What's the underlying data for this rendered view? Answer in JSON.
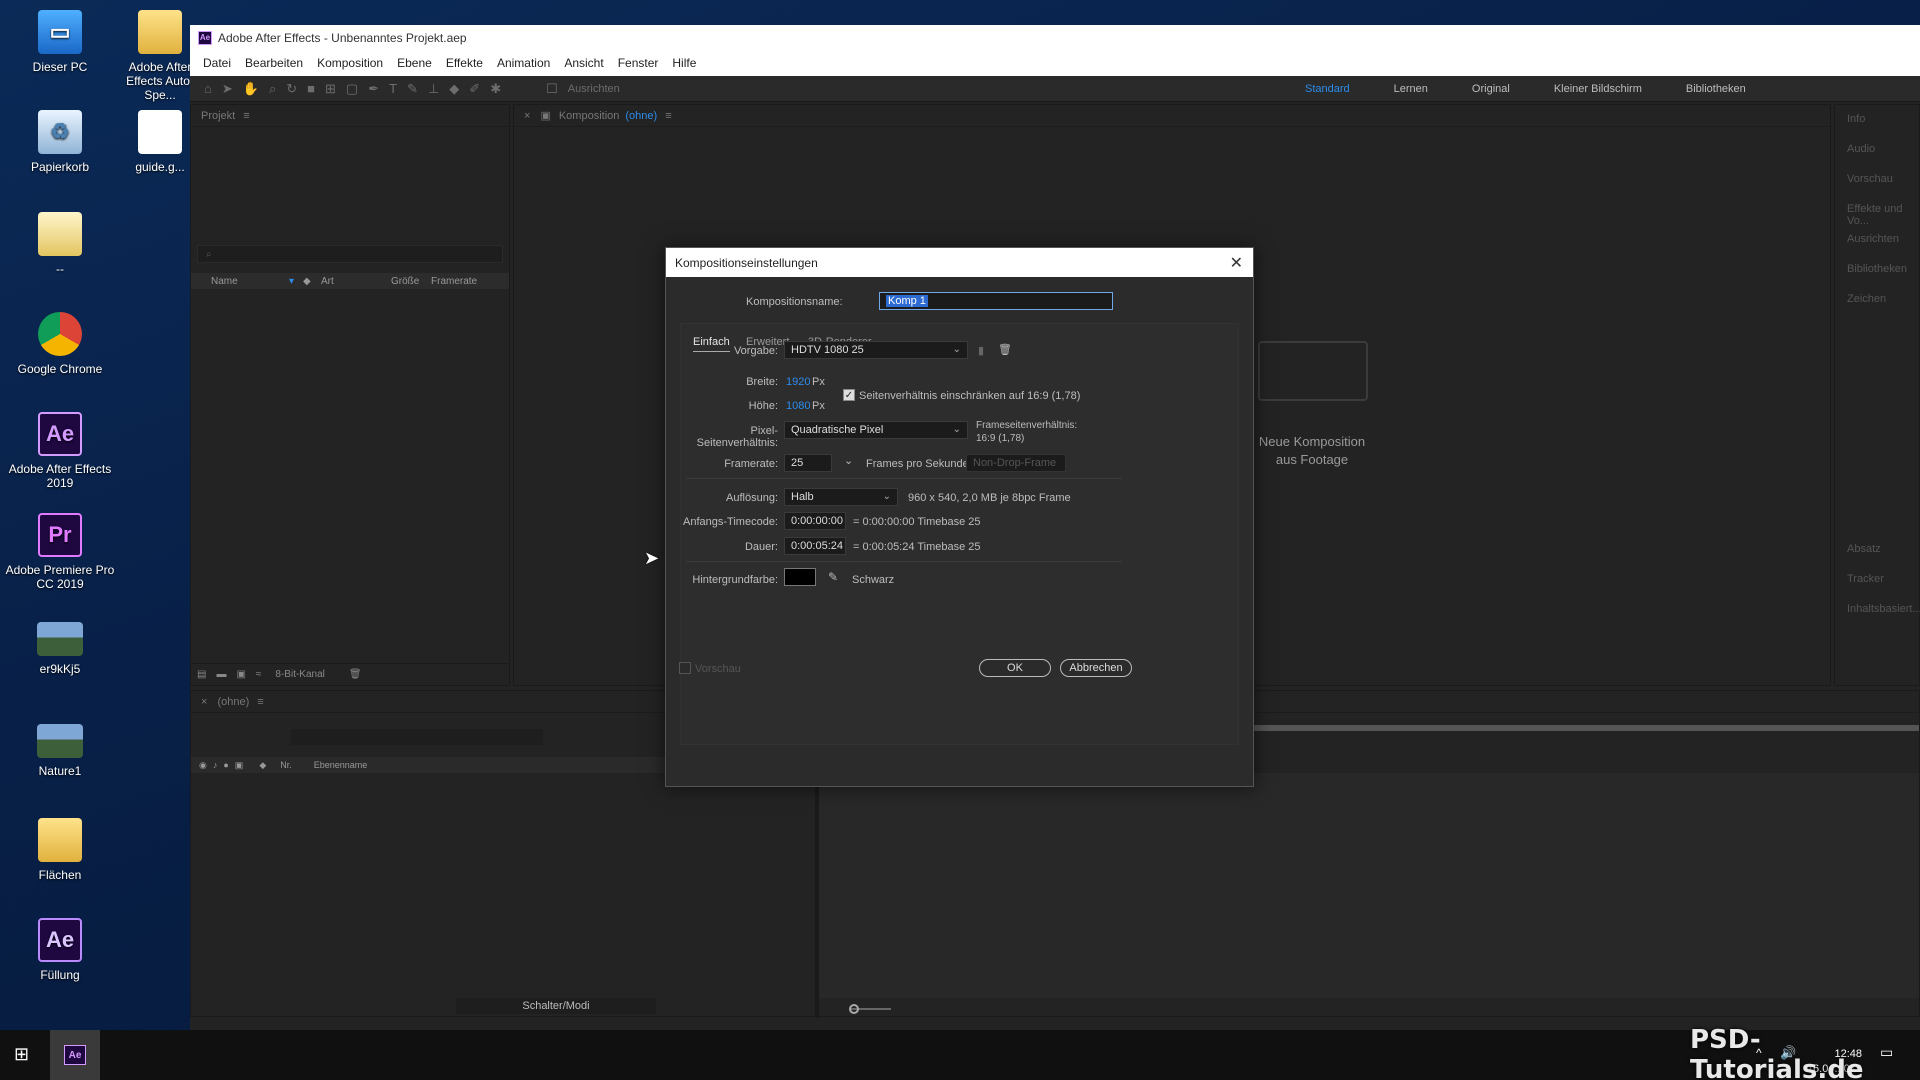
{
  "desktop": {
    "icons": [
      {
        "label": "Dieser PC"
      },
      {
        "label": "Adobe After Effects Auto-Spe..."
      },
      {
        "label": "Papierkorb"
      },
      {
        "label": "guide.g..."
      },
      {
        "label": "--"
      },
      {
        "label": "Google Chrome"
      },
      {
        "label": "Adobe After Effects 2019"
      },
      {
        "label": "Adobe Premiere Pro CC 2019"
      },
      {
        "label": "er9kKj5"
      },
      {
        "label": "Nature1"
      },
      {
        "label": "Flächen"
      },
      {
        "label": "Füllung"
      }
    ]
  },
  "app": {
    "title": "Adobe After Effects - Unbenanntes Projekt.aep",
    "menu": [
      "Datei",
      "Bearbeiten",
      "Komposition",
      "Ebene",
      "Effekte",
      "Animation",
      "Ansicht",
      "Fenster",
      "Hilfe"
    ],
    "toolbar": {
      "ausrichten_label": "Ausrichten"
    },
    "workspaces": [
      "Standard",
      "Lernen",
      "Original",
      "Kleiner Bildschirm",
      "Bibliotheken"
    ],
    "active_workspace": "Standard"
  },
  "project_panel": {
    "title": "Projekt",
    "columns": [
      "Name",
      "Art",
      "Größe",
      "Framerate"
    ],
    "footer_label": "8-Bit-Kanal"
  },
  "comp_panel": {
    "title": "Komposition",
    "title_suffix": "(ohne)",
    "new_comp_from_footage": "Neue Komposition aus Footage"
  },
  "timeline_panel": {
    "tab": "(ohne)",
    "columns": [
      "Nr.",
      "Ebenenname"
    ],
    "footer_label": "Schalter/Modi"
  },
  "right_panels": [
    "Info",
    "Audio",
    "Vorschau",
    "Effekte und Vo...",
    "Ausrichten",
    "Bibliotheken",
    "Zeichen",
    "Absatz",
    "Tracker",
    "Inhaltsbasiert..."
  ],
  "dialog": {
    "title": "Kompositionseinstellungen",
    "comp_name_label": "Kompositionsname:",
    "comp_name_value": "Komp 1",
    "tabs": [
      "Einfach",
      "Erweitert",
      "3D-Renderer"
    ],
    "preset_label": "Vorgabe:",
    "preset_value": "HDTV 1080 25",
    "width_label": "Breite:",
    "width_value": "1920",
    "height_label": "Höhe:",
    "height_value": "1080",
    "px_unit": "Px",
    "lock_aspect_label": "Seitenverhältnis einschränken auf 16:9 (1,78)",
    "pixel_aspect_label": "Pixel-Seitenverhältnis:",
    "pixel_aspect_value": "Quadratische Pixel",
    "frame_aspect_label": "Frameseitenverhältnis:",
    "frame_aspect_value": "16:9 (1,78)",
    "framerate_label": "Framerate:",
    "framerate_value": "25",
    "fps_label": "Frames pro Sekunde",
    "drop_frame_value": "Non-Drop-Frame",
    "resolution_label": "Auflösung:",
    "resolution_value": "Halb",
    "resolution_info": "960 x 540, 2,0 MB je 8bpc Frame",
    "start_tc_label": "Anfangs-Timecode:",
    "start_tc_value": "0:00:00:00",
    "start_tc_info": "= 0:00:00:00  Timebase 25",
    "duration_label": "Dauer:",
    "duration_value": "0:00:05:24",
    "duration_info": "= 0:00:05:24  Timebase 25",
    "bg_label": "Hintergrundfarbe:",
    "bg_color": "#000000",
    "bg_name": "Schwarz",
    "preview_label": "Vorschau",
    "ok_label": "OK",
    "cancel_label": "Abbrechen"
  },
  "taskbar": {
    "time": "12:48",
    "date": "16.04.2019"
  },
  "watermark": "PSD-Tutorials.de",
  "colors": {
    "accent": "#2d8ceb",
    "panel_bg": "#232323",
    "dialog_bg": "#2b2b2b"
  }
}
